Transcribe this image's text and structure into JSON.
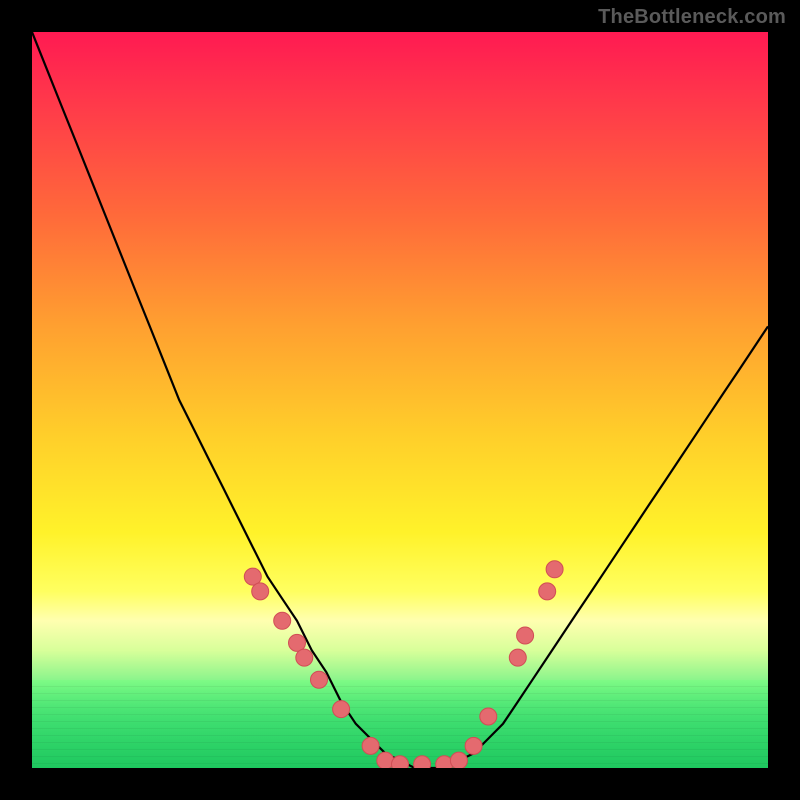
{
  "watermark_text": "TheBottleneck.com",
  "chart_data": {
    "type": "line",
    "title": "",
    "xlabel": "",
    "ylabel": "",
    "xlim": [
      0,
      100
    ],
    "ylim": [
      0,
      100
    ],
    "x": [
      0,
      2,
      4,
      6,
      8,
      10,
      12,
      14,
      16,
      18,
      20,
      22,
      24,
      26,
      28,
      30,
      32,
      34,
      36,
      38,
      40,
      42,
      44,
      46,
      48,
      50,
      52,
      54,
      56,
      58,
      60,
      62,
      64,
      66,
      68,
      70,
      72,
      74,
      76,
      78,
      80,
      82,
      84,
      86,
      88,
      90,
      92,
      94,
      96,
      98,
      100
    ],
    "y": [
      100,
      95,
      90,
      85,
      80,
      75,
      70,
      65,
      60,
      55,
      50,
      46,
      42,
      38,
      34,
      30,
      26,
      23,
      20,
      16,
      13,
      9,
      6,
      4,
      2,
      1,
      0,
      0,
      0,
      1,
      2,
      4,
      6,
      9,
      12,
      15,
      18,
      21,
      24,
      27,
      30,
      33,
      36,
      39,
      42,
      45,
      48,
      51,
      54,
      57,
      60
    ],
    "marker_points": [
      {
        "x": 30,
        "y": 26
      },
      {
        "x": 31,
        "y": 24
      },
      {
        "x": 34,
        "y": 20
      },
      {
        "x": 36,
        "y": 17
      },
      {
        "x": 37,
        "y": 15
      },
      {
        "x": 39,
        "y": 12
      },
      {
        "x": 42,
        "y": 8
      },
      {
        "x": 46,
        "y": 3
      },
      {
        "x": 48,
        "y": 1
      },
      {
        "x": 50,
        "y": 0.5
      },
      {
        "x": 53,
        "y": 0.5
      },
      {
        "x": 56,
        "y": 0.5
      },
      {
        "x": 58,
        "y": 1
      },
      {
        "x": 60,
        "y": 3
      },
      {
        "x": 62,
        "y": 7
      },
      {
        "x": 66,
        "y": 15
      },
      {
        "x": 67,
        "y": 18
      },
      {
        "x": 70,
        "y": 24
      },
      {
        "x": 71,
        "y": 27
      }
    ],
    "legend": [],
    "grid": false
  }
}
